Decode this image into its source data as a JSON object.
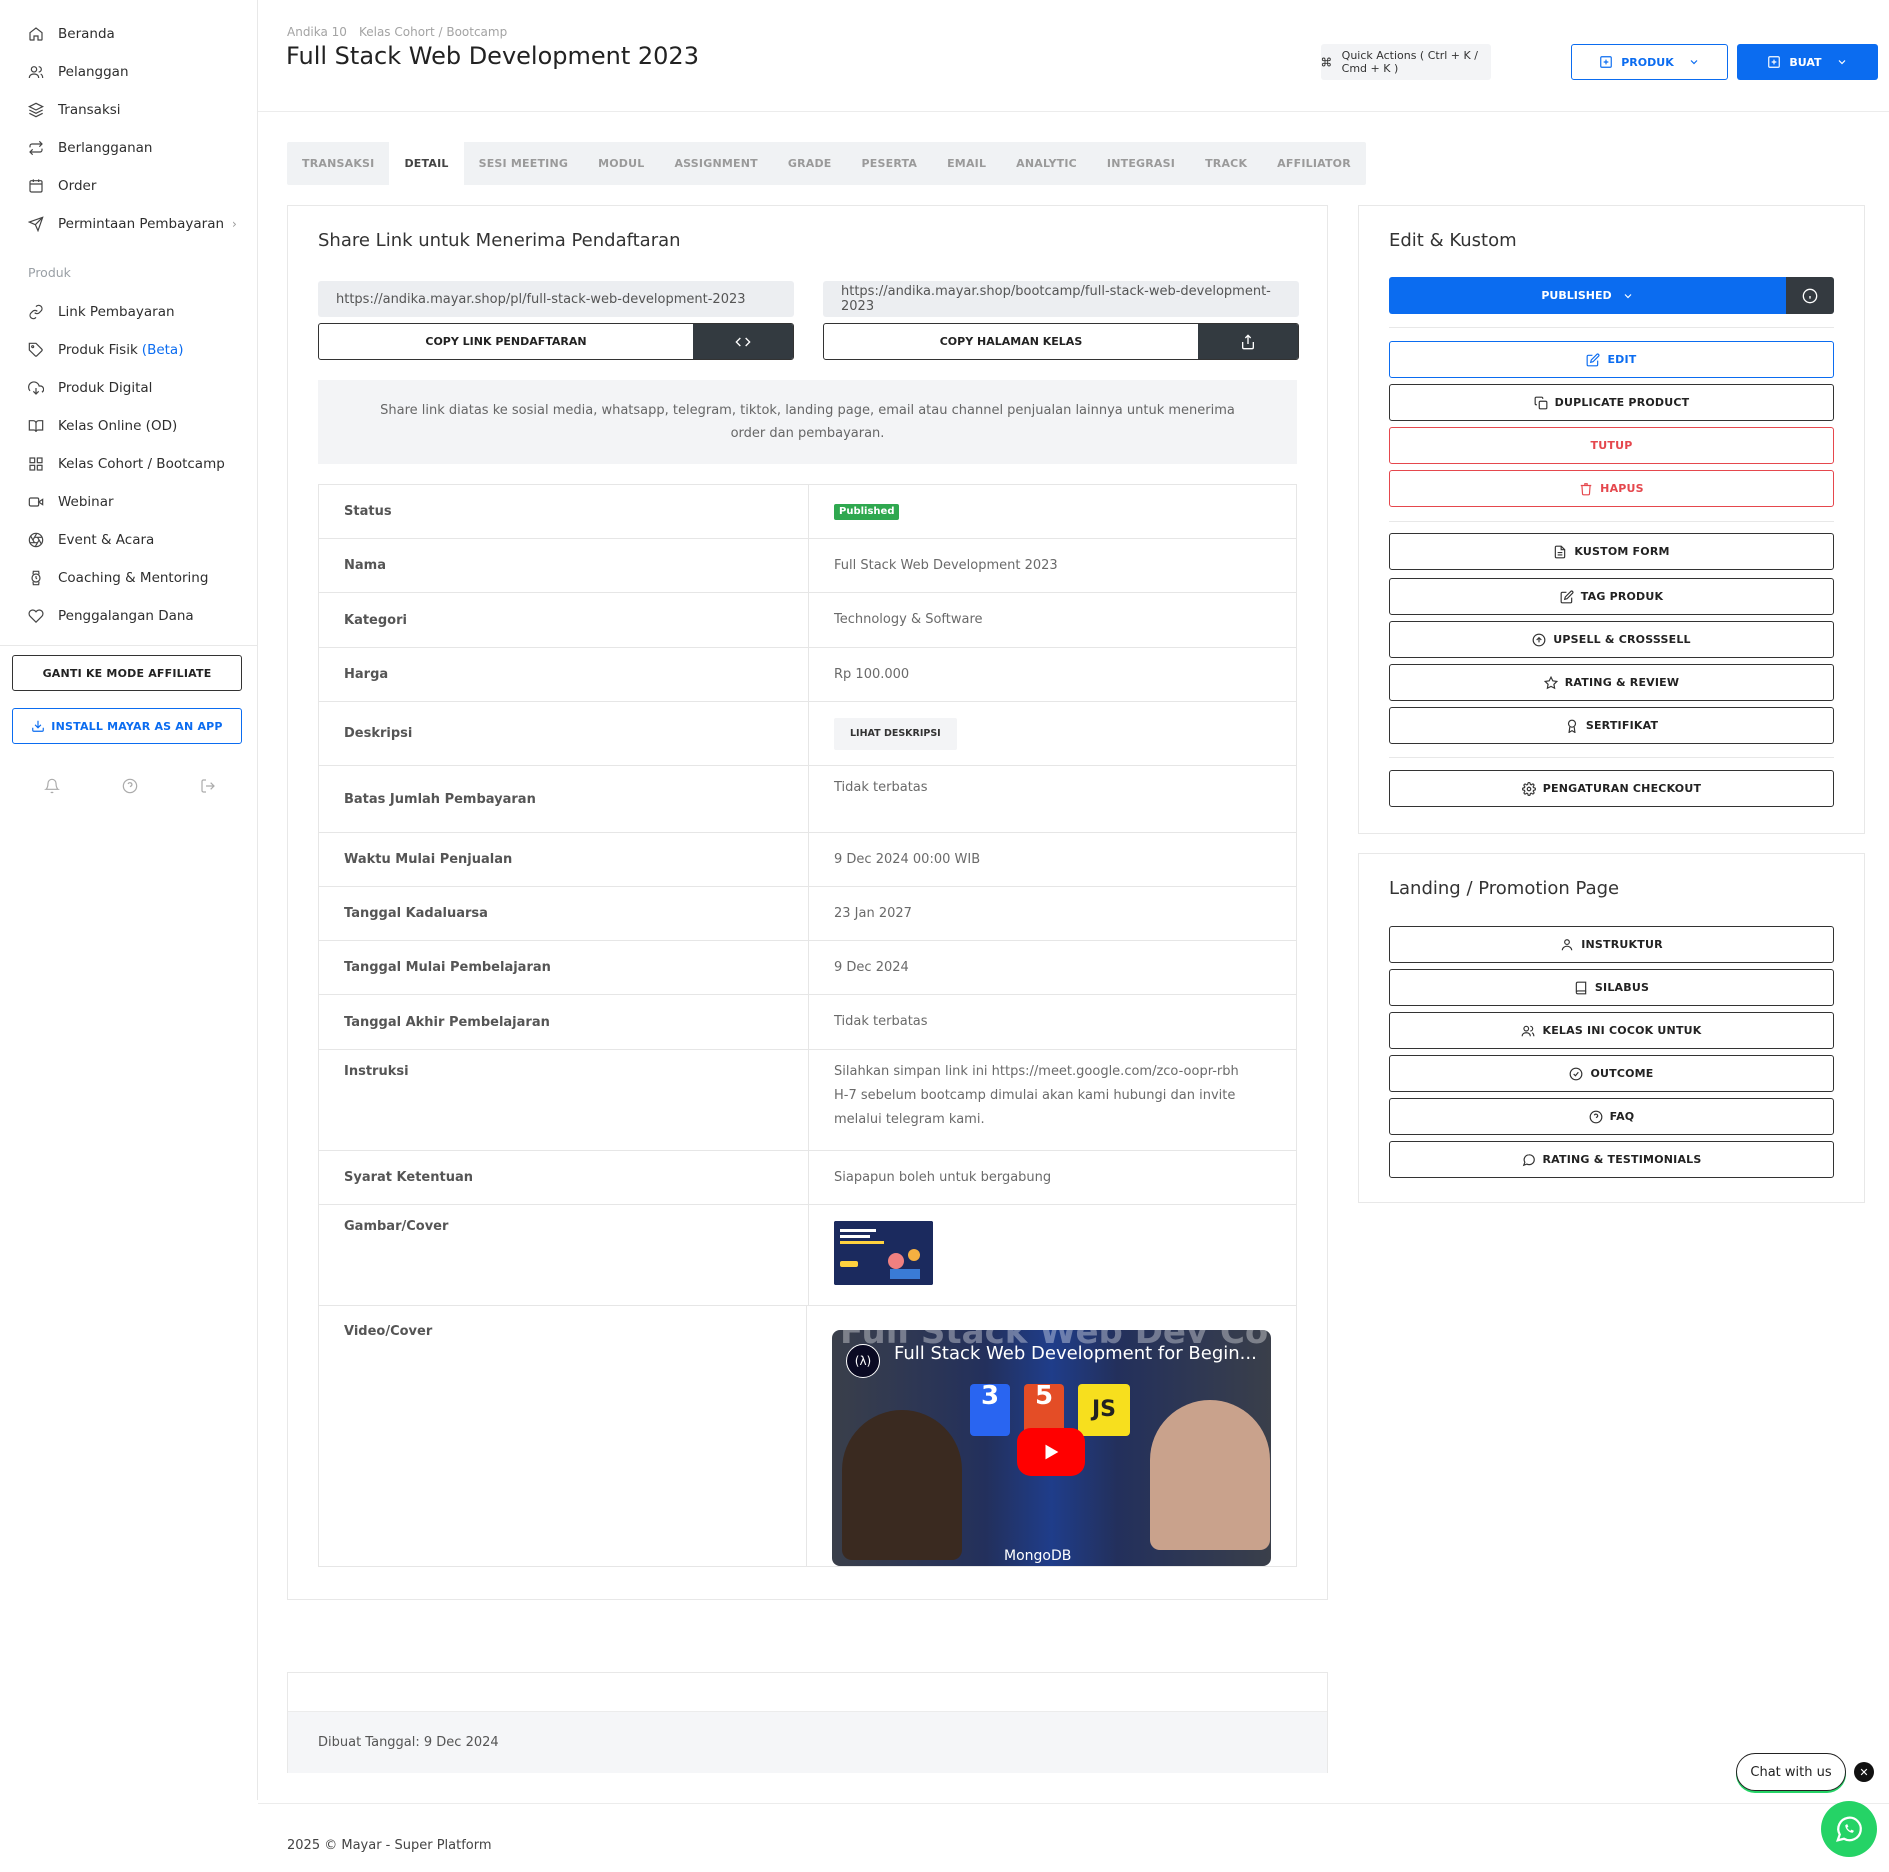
{
  "sidebar": {
    "nav": [
      {
        "label": "Beranda",
        "icon": "home-icon"
      },
      {
        "label": "Pelanggan",
        "icon": "users-icon"
      },
      {
        "label": "Transaksi",
        "icon": "layers-icon"
      },
      {
        "label": "Berlangganan",
        "icon": "repeat-icon"
      },
      {
        "label": "Order",
        "icon": "calendar-icon"
      },
      {
        "label": "Permintaan Pembayaran",
        "icon": "send-icon"
      }
    ],
    "section_label": "Produk",
    "products": [
      {
        "label": "Link Pembayaran",
        "icon": "link-icon"
      },
      {
        "label": "Produk Fisik",
        "beta": "(Beta)",
        "icon": "tag-icon"
      },
      {
        "label": "Produk Digital",
        "icon": "cloud-download-icon"
      },
      {
        "label": "Kelas Online (OD)",
        "icon": "book-open-icon"
      },
      {
        "label": "Kelas Cohort / Bootcamp",
        "icon": "grid-icon"
      },
      {
        "label": "Webinar",
        "icon": "video-icon"
      },
      {
        "label": "Event & Acara",
        "icon": "aperture-icon"
      },
      {
        "label": "Coaching & Mentoring",
        "icon": "watch-icon"
      },
      {
        "label": "Penggalangan Dana",
        "icon": "heart-icon"
      }
    ],
    "affiliate_button": "GANTI KE MODE AFFILIATE",
    "install_button": "INSTALL MAYAR AS AN APP"
  },
  "header": {
    "breadcrumb": [
      "Andika 10",
      "Kelas Cohort / Bootcamp"
    ],
    "title": "Full Stack Web Development 2023",
    "quick_actions": "Quick Actions ( Ctrl + K / Cmd + K )",
    "produk_button": "PRODUK",
    "buat_button": "BUAT"
  },
  "tabs": [
    "TRANSAKSI",
    "DETAIL",
    "SESI MEETING",
    "MODUL",
    "ASSIGNMENT",
    "GRADE",
    "PESERTA",
    "EMAIL",
    "ANALYTIC",
    "INTEGRASI",
    "TRACK",
    "AFFILIATOR"
  ],
  "active_tab": "DETAIL",
  "share": {
    "title": "Share Link untuk Menerima Pendaftaran",
    "link1": "https://andika.mayar.shop/pl/full-stack-web-development-2023",
    "link2": "https://andika.mayar.shop/bootcamp/full-stack-web-development-2023",
    "copy1": "COPY LINK PENDAFTARAN",
    "copy2": "COPY HALAMAN KELAS",
    "info": "Share link diatas ke sosial media, whatsapp, telegram, tiktok, landing page, email atau channel penjualan lainnya untuk menerima order dan pembayaran."
  },
  "details": {
    "status_label": "Status",
    "status_value": "Published",
    "nama_label": "Nama",
    "nama_value": "Full Stack Web Development 2023",
    "kategori_label": "Kategori",
    "kategori_value": "Technology & Software",
    "harga_label": "Harga",
    "harga_value": "Rp 100.000",
    "deskripsi_label": "Deskripsi",
    "deskripsi_button": "LIHAT DESKRIPSI",
    "batas_label": "Batas Jumlah Pembayaran",
    "batas_value": "Tidak terbatas",
    "waktu_label": "Waktu Mulai Penjualan",
    "waktu_value": "9 Dec 2024 00:00 WIB",
    "kadaluarsa_label": "Tanggal Kadaluarsa",
    "kadaluarsa_value": "23 Jan 2027",
    "mulai_label": "Tanggal Mulai Pembelajaran",
    "mulai_value": "9 Dec 2024",
    "akhir_label": "Tanggal Akhir Pembelajaran",
    "akhir_value": "Tidak terbatas",
    "instruksi_label": "Instruksi",
    "instruksi_value": "Silahkan simpan link ini https://meet.google.com/zco-oopr-rbh H-7 sebelum bootcamp dimulai akan kami hubungi dan invite melalui telegram kami.",
    "syarat_label": "Syarat Ketentuan",
    "syarat_value": "Siapapun boleh untuk bergabung",
    "gambar_label": "Gambar/Cover",
    "video_label": "Video/Cover",
    "video_title": "Full Stack Web Development for Begin...",
    "video_banner": "Full Stack Web Dev Course",
    "video_db": "MongoDB"
  },
  "footer_card": "Dibuat Tanggal: 9 Dec 2024",
  "page_footer": "2025 © Mayar - Super Platform",
  "edit": {
    "title": "Edit & Kustom",
    "published": "PUBLISHED",
    "edit": "EDIT",
    "duplicate": "DUPLICATE PRODUCT",
    "tutup": "TUTUP",
    "hapus": "HAPUS",
    "kustom_form": "KUSTOM FORM",
    "tag_produk": "TAG PRODUK",
    "upsell": "UPSELL & CROSSSELL",
    "rating_review": "RATING & REVIEW",
    "sertifikat": "SERTIFIKAT",
    "checkout": "PENGATURAN CHECKOUT"
  },
  "promo": {
    "title": "Landing / Promotion Page",
    "instruktur": "INSTRUKTUR",
    "silabus": "SILABUS",
    "cocok": "KELAS INI COCOK UNTUK",
    "outcome": "OUTCOME",
    "faq": "FAQ",
    "testimonials": "RATING & TESTIMONIALS"
  },
  "chat": "Chat with us",
  "colors": {
    "accent": "#0b6cf0",
    "danger": "#e5474d",
    "success": "#2fa84f",
    "dark": "#343a40",
    "whatsapp": "#25d366"
  }
}
